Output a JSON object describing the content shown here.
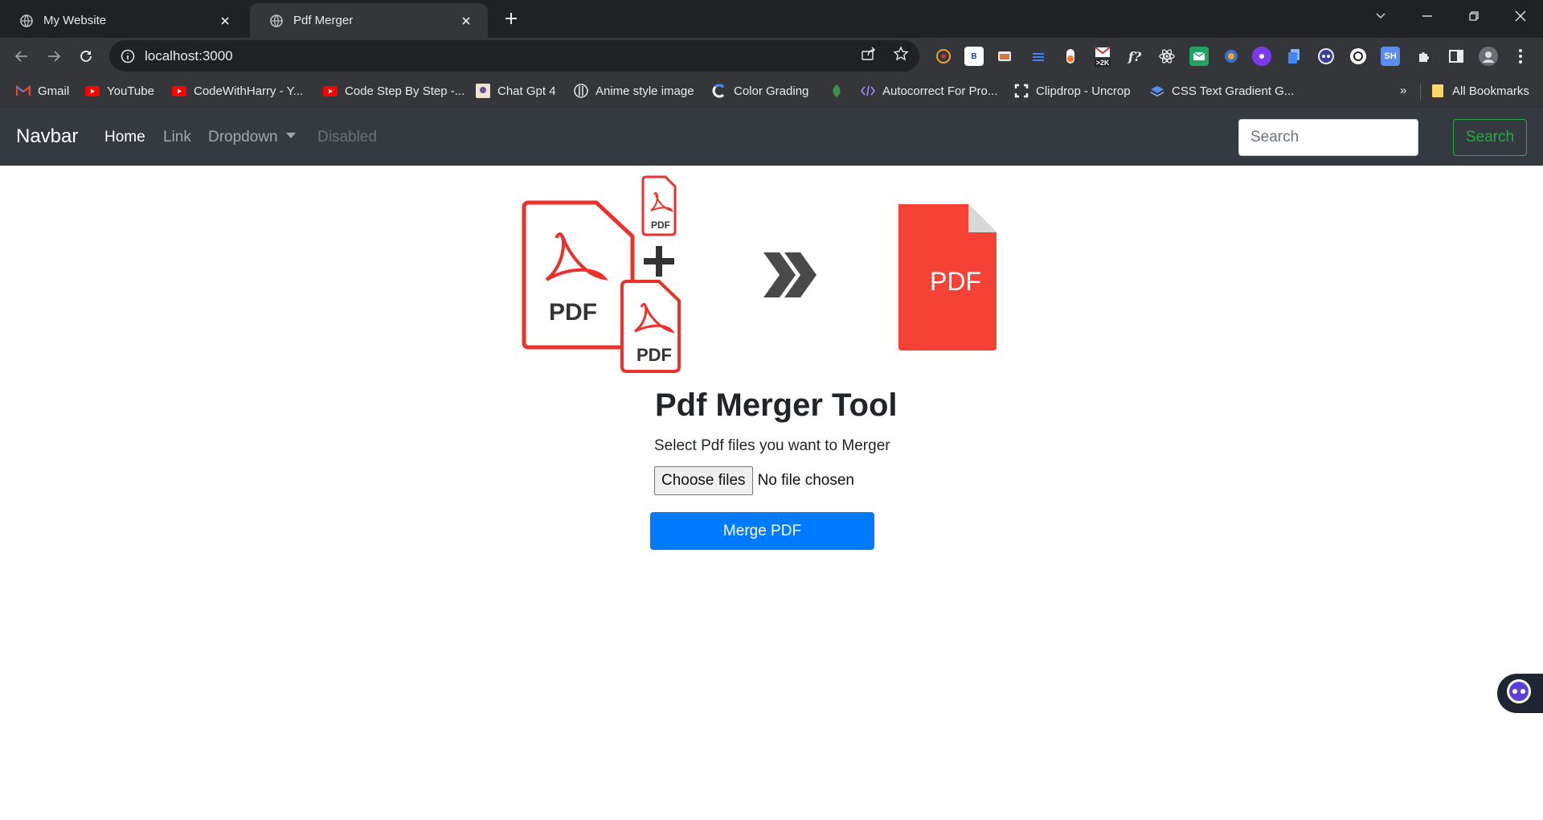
{
  "browser": {
    "tabs": [
      {
        "title": "My Website",
        "active": false,
        "icon": "globe-icon"
      },
      {
        "title": "Pdf Merger",
        "active": true,
        "icon": "globe-icon"
      }
    ],
    "url": "localhost:3000",
    "bookmarks": [
      {
        "label": "Gmail",
        "icon": "gmail-icon"
      },
      {
        "label": "YouTube",
        "icon": "youtube-icon"
      },
      {
        "label": "CodeWithHarry - Y...",
        "icon": "youtube-icon"
      },
      {
        "label": "Code Step By Step -...",
        "icon": "youtube-icon"
      },
      {
        "label": "Chat Gpt 4",
        "icon": "image-icon"
      },
      {
        "label": "Anime style image",
        "icon": "circle-icon"
      },
      {
        "label": "Color Grading",
        "icon": "color-icon"
      },
      {
        "label": "",
        "icon": "leaf-icon"
      },
      {
        "label": "Autocorrect For Pro...",
        "icon": "code-icon"
      },
      {
        "label": "Clipdrop - Uncrop",
        "icon": "clipdrop-icon"
      },
      {
        "label": "CSS Text Gradient G...",
        "icon": "css-icon"
      }
    ],
    "bookmarks_overflow": "»",
    "all_bookmarks": "All Bookmarks",
    "extension_badge": ">2K",
    "ext_b": "B",
    "ext_sh": "SH",
    "ext_f": "f?"
  },
  "navbar": {
    "brand": "Navbar",
    "links": {
      "home": "Home",
      "link": "Link",
      "dropdown": "Dropdown",
      "disabled": "Disabled"
    },
    "search_placeholder": "Search",
    "search_button": "Search"
  },
  "hero": {
    "pdf_label": "PDF"
  },
  "main": {
    "title": "Pdf Merger Tool",
    "subtitle": "Select Pdf files you want to Merger",
    "choose_files": "Choose files",
    "no_file": "No file chosen",
    "merge_button": "Merge PDF"
  },
  "colors": {
    "navbar_bg": "#343a40",
    "primary": "#007bff",
    "success": "#28a745",
    "pdf_red": "#f44336"
  }
}
